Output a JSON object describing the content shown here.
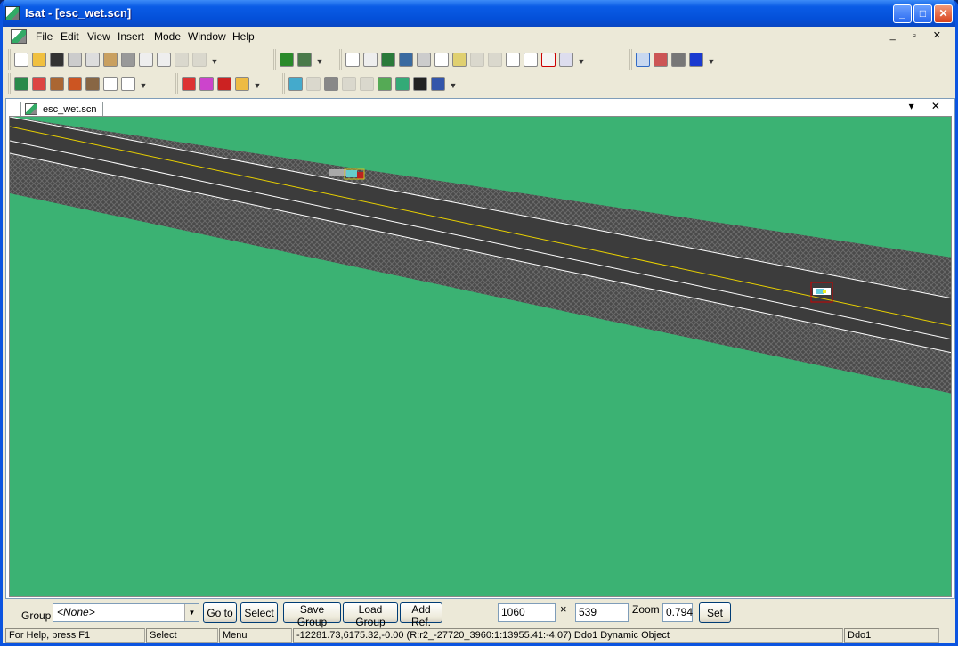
{
  "window": {
    "title": "Isat - [esc_wet.scn]",
    "minimize_label": "_",
    "maximize_label": "□",
    "close_label": "✕"
  },
  "menubar": {
    "items": [
      "File",
      "Edit",
      "View",
      "Insert",
      "Mode",
      "Window",
      "Help"
    ],
    "mdi_controls": "_ ▫ ✕"
  },
  "document": {
    "tab_label": "esc_wet.scn",
    "tab_controls": "▾ ✕"
  },
  "bottom_bar": {
    "group_label": "Group",
    "group_value": "<None>",
    "goto_label": "Go to",
    "select_label": "Select",
    "save_group_label": "Save Group",
    "load_group_label": "Load Group",
    "add_ref_label": "Add Ref.",
    "x_value": "1060",
    "x_separator": "×",
    "y_value": "539",
    "zoom_label": "Zoom",
    "zoom_value": "0.794",
    "set_label": "Set"
  },
  "statusbar": {
    "help_text": "For Help, press F1",
    "mode": "Select",
    "menu": "Menu",
    "position_info": "-12281.73,6175.32,-0.00 (R:r2_-27720_3960:1:13955.41:-4.07) Ddo1 Dynamic Object",
    "object_name": "Ddo1"
  },
  "colors": {
    "terrain": "#3bb273",
    "road": "#3c3c3c",
    "shoulder": "#4a4a4a",
    "center_line": "#e8d000",
    "lane_line": "#ffffff"
  },
  "icons": {
    "toolbar_row1": [
      "new-file-icon",
      "open-folder-icon",
      "save-icon",
      "cut-icon",
      "copy-icon",
      "paste-icon",
      "print-icon",
      "help-icon",
      "context-help-icon",
      "undo-icon",
      "redo-icon",
      "grid-icon",
      "terrain-icon",
      "pointer-icon",
      "zoom-icon",
      "globe-icon",
      "image-icon",
      "target-icon",
      "d-tool-icon",
      "vehicle-tool-icon",
      "undo2-icon",
      "redo2-icon",
      "link-icon",
      "node-icon",
      "checkbox-icon",
      "n-tool-icon",
      "line-draw-icon",
      "map-icon",
      "monitor-icon",
      "play-icon"
    ],
    "toolbar_row2": [
      "scenario-icon",
      "columns-icon",
      "film-icon",
      "film2-icon",
      "exit-icon",
      "ft-text-icon",
      "ab-text-icon",
      "car-red-icon",
      "car-group-icon",
      "car-icon",
      "pedestrian-icon",
      "cloud-icon",
      "light-icon",
      "screen-icon",
      "road-icon",
      "sign-icon",
      "tree-icon",
      "landscape-icon",
      "night-icon",
      "calendar-icon"
    ]
  }
}
